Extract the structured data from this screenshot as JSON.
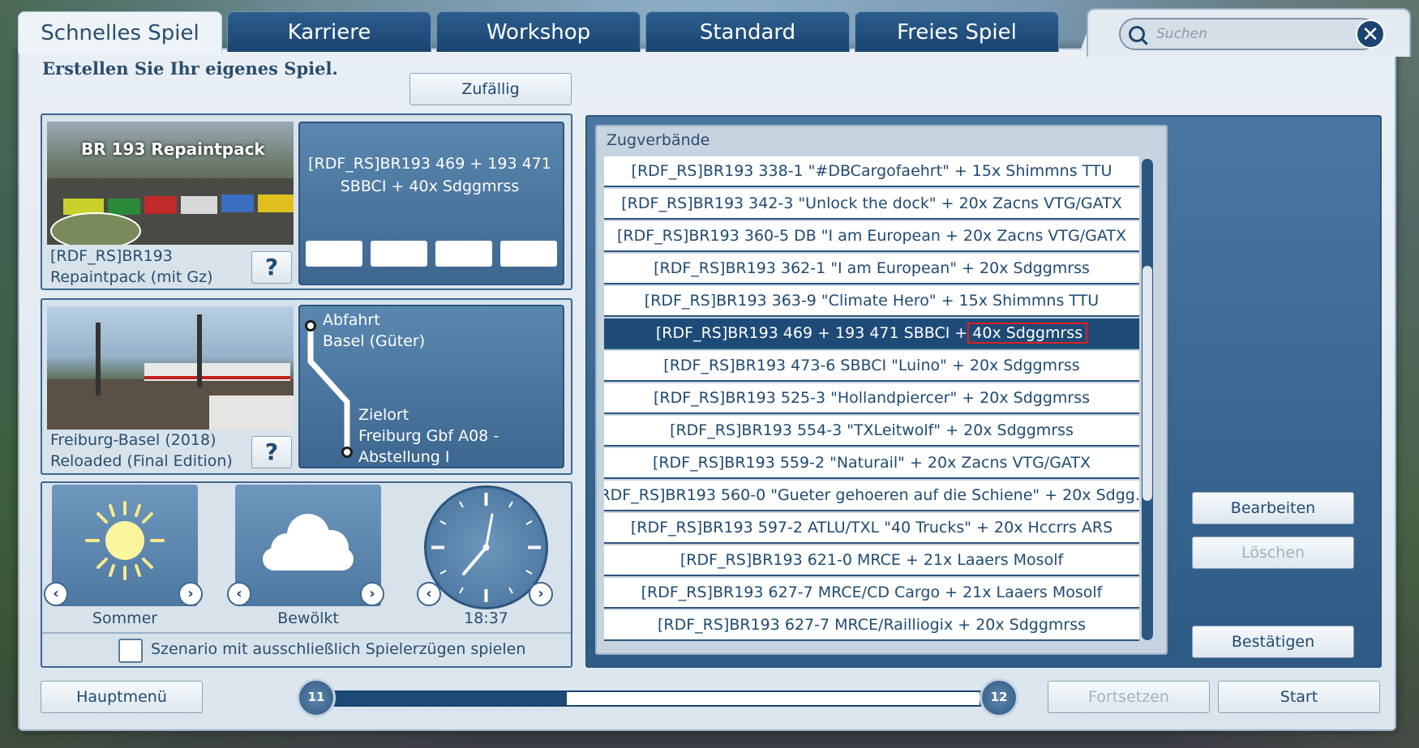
{
  "tabs": [
    {
      "label": "Schnelles Spiel",
      "active": true
    },
    {
      "label": "Karriere",
      "active": false
    },
    {
      "label": "Workshop",
      "active": false
    },
    {
      "label": "Standard",
      "active": false
    },
    {
      "label": "Freies Spiel",
      "active": false
    }
  ],
  "search": {
    "placeholder": "Suchen"
  },
  "heading": "Erstellen Sie Ihr eigenes Spiel.",
  "random_button": "Zufällig",
  "route_pack": {
    "thumb_title": "BR 193 Repaintpack",
    "name_line1": "[RDF_RS]BR193",
    "name_line2": "Repaintpack (mit Gz)",
    "help": "?"
  },
  "consist_preview": {
    "line1": "[RDF_RS]BR193 469 + 193 471",
    "line2": "SBBCI + 40x Sdggmrss"
  },
  "route": {
    "name_line1": "Freiburg-Basel (2018)",
    "name_line2": "Reloaded (Final Edition)",
    "help": "?",
    "departure_label": "Abfahrt",
    "departure": "Basel (Güter)",
    "destination_label": "Zielort",
    "destination_line1": "Freiburg Gbf A08 -",
    "destination_line2": "Abstellung I"
  },
  "conditions": {
    "season": "Sommer",
    "weather": "Bewölkt",
    "time": "18:37"
  },
  "player_only_checkbox": {
    "label": "Szenario mit ausschließlich Spielerzügen spielen",
    "checked": false
  },
  "consists": {
    "title": "Zugverbände",
    "items": [
      "[RDF_RS]BR193 338-1 \"#DBCargofaehrt\" + 15x Shimmns TTU",
      "[RDF_RS]BR193 342-3 \"Unlock the dock\" + 20x Zacns VTG/GATX",
      "[RDF_RS]BR193 360-5 DB \"I am European + 20x Zacns VTG/GATX",
      "[RDF_RS]BR193 362-1 \"I am European\" + 20x Sdggmrss",
      "[RDF_RS]BR193 363-9 \"Climate Hero\" + 15x Shimmns TTU",
      "[RDF_RS]BR193 469 + 193 471 SBBCI + 40x Sdggmrss",
      "[RDF_RS]BR193 473-6 SBBCI \"Luino\" + 20x Sdggmrss",
      "[RDF_RS]BR193 525-3 \"Hollandpiercer\" + 20x Sdggmrss",
      "[RDF_RS]BR193 554-3 \"TXLeitwolf\" + 20x Sdggmrss",
      "[RDF_RS]BR193 559-2 \"Naturail\" + 20x Zacns VTG/GATX",
      "[RDF_RS]BR193 560-0 \"Gueter gehoeren auf die Schiene\" + 20x Sdgg...",
      "[RDF_RS]BR193 597-2 ATLU/TXL \"40 Trucks\" + 20x Hccrrs ARS",
      "[RDF_RS]BR193 621-0 MRCE + 21x Laaers Mosolf",
      "[RDF_RS]BR193 627-7 MRCE/CD Cargo + 21x Laaers Mosolf",
      "[RDF_RS]BR193 627-7 MRCE/Railliogix + 20x Sdggmrss"
    ],
    "selected_index": 5,
    "selected_prefix": "[RDF_RS]BR193 469 + 193 471 SBBCI + ",
    "selected_highlight": "40x Sdggmrss"
  },
  "side_buttons": {
    "edit": "Bearbeiten",
    "delete": "Löschen",
    "confirm": "Bestätigen"
  },
  "footer": {
    "main_menu": "Hauptmenü",
    "continue": "Fortsetzen",
    "start": "Start",
    "progress_start": "11",
    "progress_end": "12",
    "progress_fraction": 0.36
  },
  "colors": {
    "accent": "#1e4a78",
    "highlight_border": "#e02020"
  }
}
